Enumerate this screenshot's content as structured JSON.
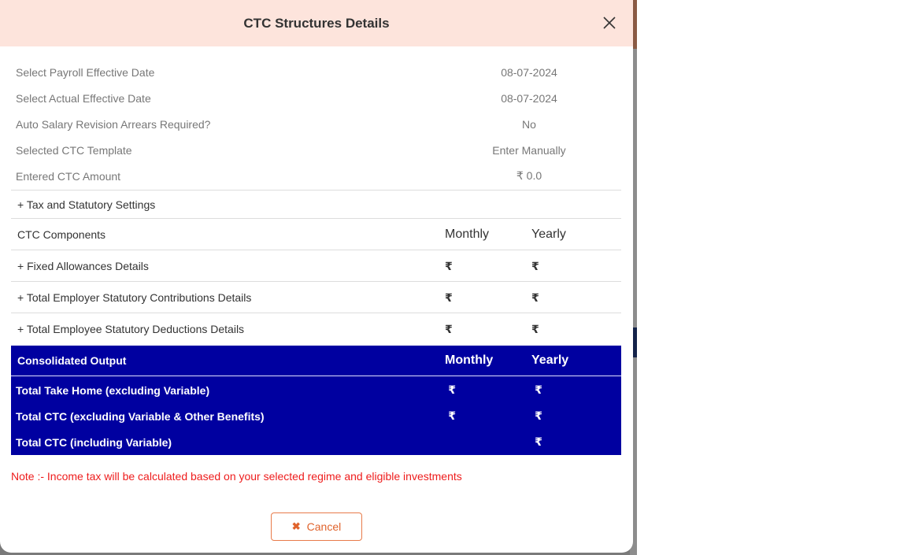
{
  "modal": {
    "title": "CTC Structures Details",
    "close_icon": "close-icon"
  },
  "info": [
    {
      "label": "Select Payroll Effective Date",
      "value": "08-07-2024"
    },
    {
      "label": "Select Actual Effective Date",
      "value": "08-07-2024"
    },
    {
      "label": "Auto Salary Revision Arrears Required?",
      "value": "No"
    },
    {
      "label": "Selected CTC Template",
      "value": "Enter Manually"
    },
    {
      "label": "Entered CTC Amount",
      "value": "₹ 0.0"
    }
  ],
  "tax_settings_label": "+ Tax and Statutory Settings",
  "components": {
    "header": {
      "label": "CTC Components",
      "monthly": "Monthly",
      "yearly": "Yearly"
    },
    "rows": [
      {
        "label": "+ Fixed Allowances Details",
        "monthly": "₹",
        "yearly": "₹"
      },
      {
        "label": "+ Total Employer Statutory Contributions Details",
        "monthly": "₹",
        "yearly": "₹"
      },
      {
        "label": "+ Total Employee Statutory Deductions Details",
        "monthly": "₹",
        "yearly": "₹"
      }
    ]
  },
  "output": {
    "header": {
      "label": "Consolidated Output",
      "monthly": "Monthly",
      "yearly": "Yearly"
    },
    "rows": [
      {
        "label": "Total Take Home (excluding Variable)",
        "monthly": "₹",
        "yearly": "₹"
      },
      {
        "label": "Total CTC (excluding Variable & Other Benefits)",
        "monthly": "₹",
        "yearly": "₹"
      },
      {
        "label": "Total CTC (including Variable)",
        "monthly": "",
        "yearly": "₹"
      }
    ]
  },
  "note": "Note :- Income tax will be calculated based on your selected regime and eligible investments",
  "cancel_button": {
    "label": "Cancel",
    "icon": "close-x-icon"
  },
  "colors": {
    "header_bg": "#fde4dc",
    "output_bg": "#0000a0",
    "note": "#ee1c1c",
    "cancel_accent": "#e0632c"
  }
}
